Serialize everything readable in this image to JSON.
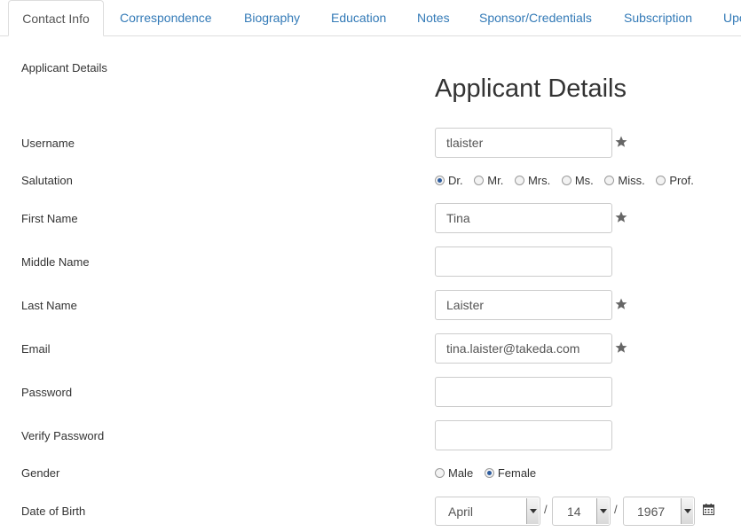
{
  "tabs": [
    {
      "label": "Contact Info"
    },
    {
      "label": "Correspondence"
    },
    {
      "label": "Biography"
    },
    {
      "label": "Education"
    },
    {
      "label": "Notes"
    },
    {
      "label": "Sponsor/Credentials"
    },
    {
      "label": "Subscription"
    },
    {
      "label": "Upc"
    }
  ],
  "section_label": "Applicant Details",
  "heading": "Applicant Details",
  "fields": {
    "username": {
      "label": "Username",
      "value": "tlaister"
    },
    "salutation": {
      "label": "Salutation",
      "options": [
        "Dr.",
        "Mr.",
        "Mrs.",
        "Ms.",
        "Miss.",
        "Prof."
      ],
      "selected": "Dr."
    },
    "first_name": {
      "label": "First Name",
      "value": "Tina"
    },
    "middle_name": {
      "label": "Middle Name",
      "value": ""
    },
    "last_name": {
      "label": "Last Name",
      "value": "Laister"
    },
    "email": {
      "label": "Email",
      "value": "tina.laister@takeda.com"
    },
    "password": {
      "label": "Password",
      "value": ""
    },
    "verify_password": {
      "label": "Verify Password",
      "value": ""
    },
    "gender": {
      "label": "Gender",
      "options": [
        "Male",
        "Female"
      ],
      "selected": "Female"
    },
    "dob": {
      "label": "Date of Birth",
      "month": "April",
      "day": "14",
      "year": "1967",
      "separator": "/"
    }
  },
  "icons": {
    "required": "star-icon",
    "calendar": "calendar-icon"
  },
  "colors": {
    "link": "#337ab7",
    "star": "#666666",
    "radio_dot": "#2d5c9e"
  }
}
